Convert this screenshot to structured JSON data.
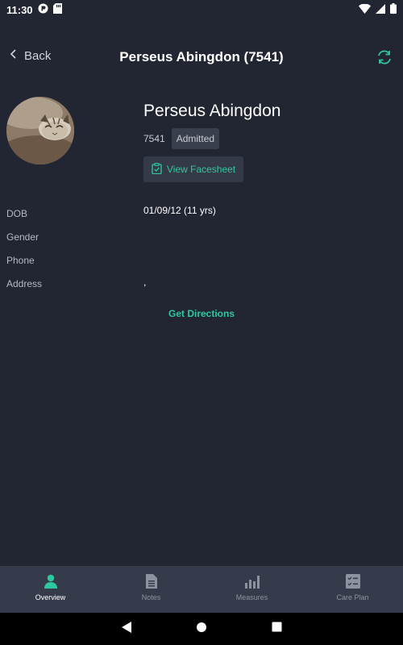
{
  "status_bar": {
    "time": "11:30"
  },
  "header": {
    "back_label": "Back",
    "title": "Perseus Abingdon (7541)"
  },
  "patient": {
    "name": "Perseus Abingdon",
    "id": "7541",
    "status": "Admitted",
    "facesheet_label": "View Facesheet"
  },
  "info": {
    "dob_label": "DOB",
    "dob_value": "01/09/12 (11 yrs)",
    "gender_label": "Gender",
    "gender_value": "",
    "phone_label": "Phone",
    "phone_value": "",
    "address_label": "Address",
    "address_value": ","
  },
  "directions_label": "Get Directions",
  "bottom_nav": {
    "items": [
      {
        "label": "Overview",
        "icon": "person-icon",
        "active": true
      },
      {
        "label": "Notes",
        "icon": "document-icon",
        "active": false
      },
      {
        "label": "Measures",
        "icon": "bar-chart-icon",
        "active": false
      },
      {
        "label": "Care Plan",
        "icon": "checklist-icon",
        "active": false
      }
    ]
  },
  "colors": {
    "background": "#222633",
    "accent": "#2ec8a0",
    "nav_background": "#363b4b"
  }
}
